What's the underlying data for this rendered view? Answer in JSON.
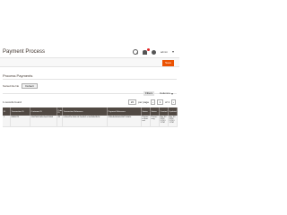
{
  "header": {
    "title": "Payment Process",
    "user_name": "admin"
  },
  "actions": {
    "primary_label": "Save"
  },
  "section": {
    "title": "Process Payments"
  },
  "scope": {
    "label": "Sorted tile No",
    "button_label": "Default"
  },
  "toolbar": {
    "filters_label": "Filters",
    "columns_label": "Columns",
    "records_found": "1 records found",
    "per_page": "20",
    "per_page_label": "per page",
    "current_page": "1",
    "of_pages": "of 1"
  },
  "grid": {
    "columns": [
      "ID",
      "Transaction ID",
      "Customer ID",
      "Order ID",
      "Transaction Reference",
      "Payment Reference",
      "Status",
      "Status",
      "Created",
      "Updated"
    ],
    "rows": [
      [
        "1",
        "8846073",
        "0f0d7b6f-5d6a3aa8-94d0",
        "46",
        "ce0eed7a-2a6c-4c7a-b5c1-e1af2d6e9b7d",
        "c6f0a6e0b4a4d1d77a8b3c",
        "Payment process",
        "Processing",
        "Mar 30 2018 2:23:11 PM",
        "Mar 30 2018 2:23:11 PM"
      ]
    ]
  },
  "colors": {
    "accent": "#eb5202",
    "grid_header": "#514943"
  }
}
